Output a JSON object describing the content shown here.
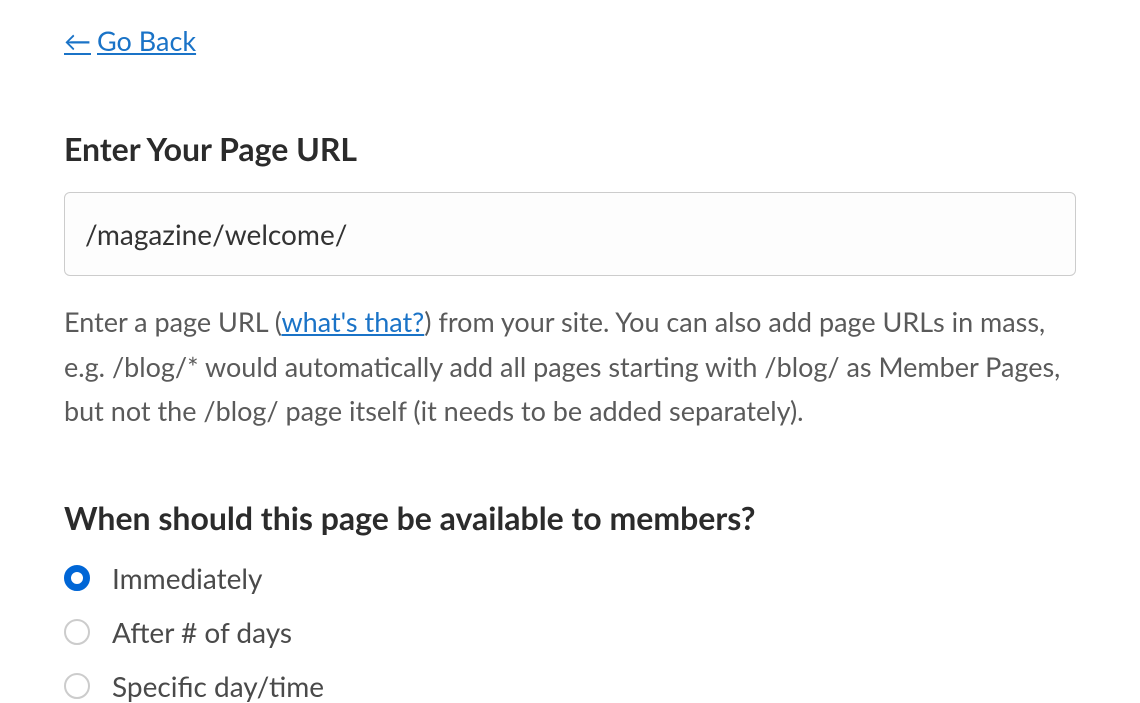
{
  "nav": {
    "go_back": "Go Back"
  },
  "url_section": {
    "heading": "Enter Your Page URL",
    "input_value": "/magazine/welcome/",
    "helper_pre": "Enter a page URL (",
    "helper_link": "what's that?",
    "helper_post": ") from your site. You can also add page URLs in mass, e.g. /blog/* would automatically add all pages starting with /blog/ as Member Pages, but not the /blog/ page itself (it needs to be added separately)."
  },
  "availability": {
    "heading": "When should this page be available to members?",
    "options": [
      {
        "label": "Immediately",
        "selected": true
      },
      {
        "label": "After # of days",
        "selected": false
      },
      {
        "label": "Specific day/time",
        "selected": false
      }
    ]
  }
}
